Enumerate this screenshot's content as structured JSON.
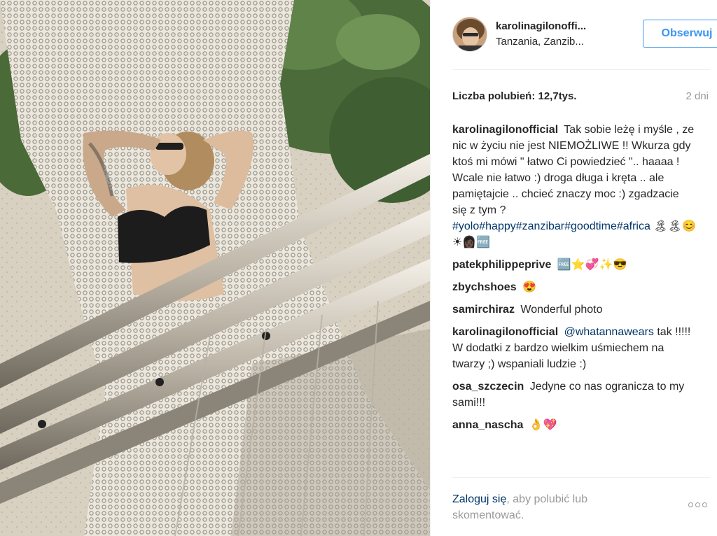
{
  "post": {
    "photo_alt": ""
  },
  "header": {
    "username": "karolinagilonoffi...",
    "location": "Tanzania, Zanzib...",
    "follow_label": "Obserwuj"
  },
  "stats": {
    "likes": "Liczba polubień: 12,7tys.",
    "age": "2 dni"
  },
  "comments": [
    {
      "user": "karolinagilonofficial",
      "text": "Tak sobie leżę i myśle , ze nic w życiu nie jest NIEMOŻLIWE !! Wkurza gdy ktoś mi mówi \" łatwo Ci powiedzieć \".. haaaa ! Wcale nie łatwo :) droga długa i kręta .. ale pamiętajcie .. chcieć znaczy moc :) zgadzacie się z tym ?",
      "tags": "#yolo#happy#zanzibar#goodtime#africa",
      "emoji": "🏝🏝😊☀👩🏿🆓"
    },
    {
      "user": "patekphilippeprive",
      "text": "🆓⭐💞✨😎"
    },
    {
      "user": "zbychshoes",
      "text": "😍"
    },
    {
      "user": "samirchiraz",
      "text": "Wonderful photo"
    },
    {
      "user": "karolinagilonofficial",
      "mention": "@whatannawears",
      "text": "tak !!!!! W dodatki z bardzo wielkim uśmiechem na twarzy ;) wspaniali ludzie :)"
    },
    {
      "user": "osa_szczecin",
      "text": "Jedyne co nas ogranicza to my sami!!!"
    },
    {
      "user": "anna_nascha",
      "text": "👌💖"
    }
  ],
  "footer": {
    "login_link": "Zaloguj się",
    "login_rest": ", aby polubić lub skomentować."
  },
  "colors": {
    "link_blue": "#003569",
    "button_blue": "#3897f0",
    "muted_gray": "#999999"
  }
}
